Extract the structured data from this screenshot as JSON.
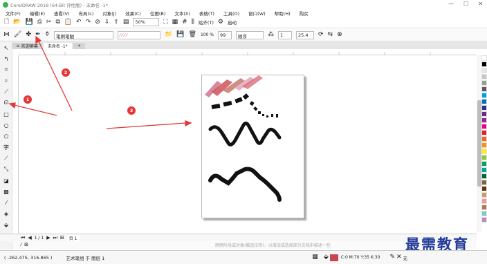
{
  "window": {
    "title": "CorelDRAW 2018 (64-Bit 评估版) - 未命名 -1*",
    "controls": [
      "—",
      "☐",
      "✕"
    ]
  },
  "menu": [
    "文件(F)",
    "编辑(E)",
    "查看(V)",
    "布局(L)",
    "对象(J)",
    "效果(C)",
    "位图(B)",
    "文本(X)",
    "表格(T)",
    "工具(O)",
    "窗口(W)",
    "帮助(H)",
    "购买"
  ],
  "toolbar1": {
    "zoom": "50%",
    "snap_label": "贴齐(T)",
    "launch_label": "启动"
  },
  "toolbar2": {
    "preset_label": "笔刷笔触",
    "smoothing": "100",
    "smoothing_unit": "%",
    "size": "99",
    "stroke_order": "顺序",
    "width_value": "1",
    "width_mm": "25.4"
  },
  "tabs": {
    "welcome": "欢迎屏幕",
    "document": "未命名 -1*"
  },
  "pagebar": {
    "page_label": "页 1"
  },
  "hint": "跨跨阶段或对象(触造位移)，以增加或选择部分文档中描述一些",
  "status": {
    "coords": "( -262.475, 316.865 )",
    "object": "艺术笔组 于 图层 1",
    "color_info": "C:0 M:70 Y:35 K:30",
    "outline": "无"
  },
  "annotations": [
    "1",
    "2",
    "3"
  ],
  "watermark": "最需教育",
  "colors": {
    "arrow": "#e23a3a",
    "accent_fill": "#c9474f",
    "ink": "#111111"
  },
  "palette": [
    "#ffffff",
    "#000000",
    "#e6e6e6",
    "#c8c8c8",
    "#9b9b9b",
    "#5a5a5a",
    "#00a0e3",
    "#0070c0",
    "#2e3192",
    "#662d91",
    "#92278f",
    "#ec008c",
    "#ed1c24",
    "#f26522",
    "#f7941d",
    "#fff200",
    "#8dc63f",
    "#00a651",
    "#00a99d",
    "#006838",
    "#8b5e3c",
    "#603913",
    "#c69c6d",
    "#f5989d",
    "#a67c52",
    "#7accc8",
    "#bd8cbf"
  ]
}
